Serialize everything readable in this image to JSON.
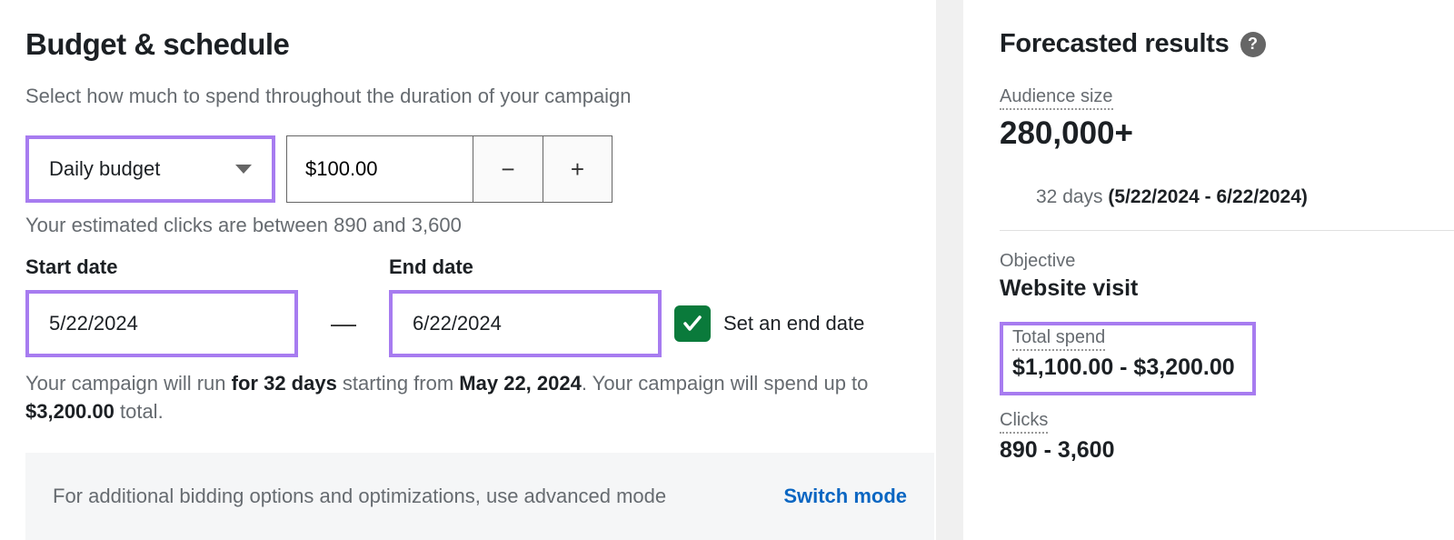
{
  "header": {
    "title": "Budget & schedule",
    "subhead": "Select how much to spend throughout the duration of your campaign"
  },
  "budget": {
    "type_label": "Daily budget",
    "amount": "$100.00",
    "estimate_note": "Your estimated clicks are between 890 and 3,600"
  },
  "dates": {
    "start_label": "Start date",
    "start_value": "5/22/2024",
    "end_label": "End date",
    "end_value": "6/22/2024",
    "dash": "—",
    "set_end_label": "Set an end date",
    "run_info_pre": "Your campaign will run ",
    "run_info_days": "for 32 days",
    "run_info_mid": " starting from ",
    "run_info_startdate": "May 22, 2024",
    "run_info_tail1": ". Your campaign will spend up to ",
    "run_info_total": "$3,200.00",
    "run_info_tail2": " total."
  },
  "advanced": {
    "text": "For additional bidding options and optimizations, use advanced mode",
    "switch_label": "Switch mode"
  },
  "forecast": {
    "title": "Forecasted results",
    "audience_label": "Audience size",
    "audience_value": "280,000+",
    "duration_days": "32 days",
    "duration_range": "(5/22/2024 - 6/22/2024)",
    "objective_label": "Objective",
    "objective_value": "Website visit",
    "spend_label": "Total spend",
    "spend_value": "$1,100.00 - $3,200.00",
    "clicks_label": "Clicks",
    "clicks_value": "890 - 3,600"
  },
  "icons": {
    "minus": "−",
    "plus": "+",
    "help": "?"
  }
}
